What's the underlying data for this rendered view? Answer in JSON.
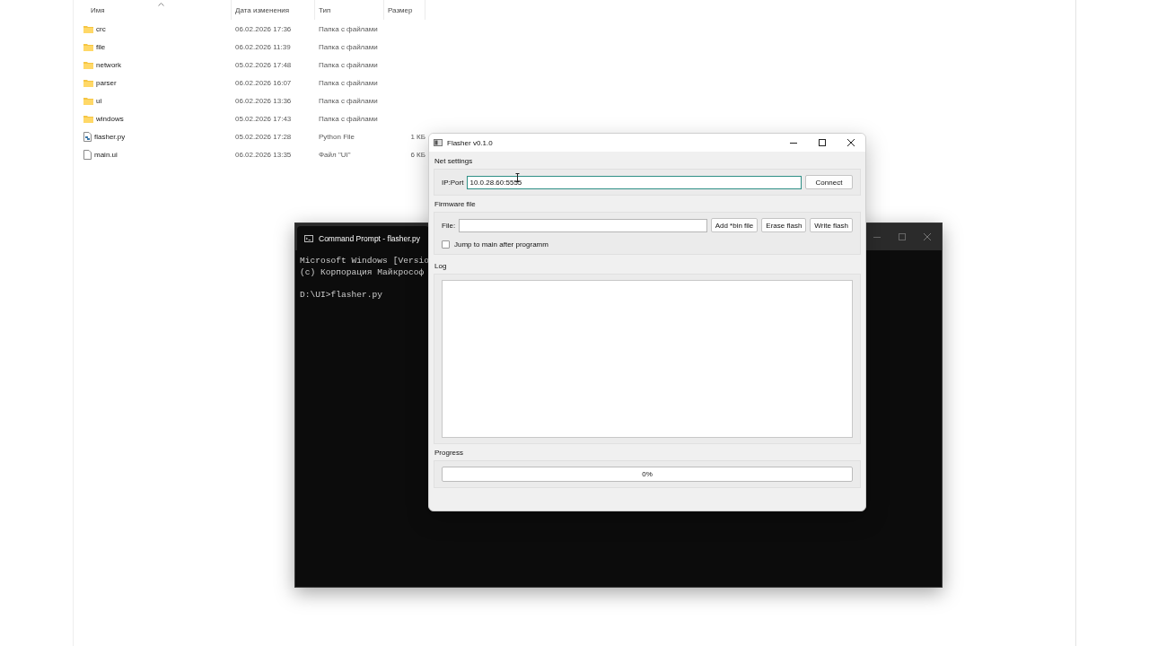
{
  "explorer": {
    "columns": [
      "Имя",
      "Дата изменения",
      "Тип",
      "Размер"
    ],
    "rows": [
      {
        "kind": "folder",
        "name": "crc",
        "date": "06.02.2026 17:36",
        "type": "Папка с файлами"
      },
      {
        "kind": "folder",
        "name": "file",
        "date": "06.02.2026 11:39",
        "type": "Папка с файлами"
      },
      {
        "kind": "folder",
        "name": "network",
        "date": "05.02.2026 17:48",
        "type": "Папка с файлами"
      },
      {
        "kind": "folder",
        "name": "parser",
        "date": "06.02.2026 16:07",
        "type": "Папка с файлами"
      },
      {
        "kind": "folder",
        "name": "ui",
        "date": "06.02.2026 13:36",
        "type": "Папка с файлами"
      },
      {
        "kind": "folder",
        "name": "windows",
        "date": "05.02.2026 17:43",
        "type": "Папка с файлами"
      },
      {
        "kind": "python",
        "name": "flasher.py",
        "date": "05.02.2026 17:28",
        "type": "Python File",
        "size": "1 КБ"
      },
      {
        "kind": "file",
        "name": "main.ui",
        "date": "06.02.2026 13:35",
        "type": "Файл \"UI\"",
        "size": "6 КБ"
      }
    ]
  },
  "console": {
    "title": "Command Prompt - flasher.py",
    "blocks": [
      {
        "lines": [
          "Microsoft Windows [Versio",
          "(c) Корпорация Майкрософ"
        ]
      },
      {
        "lines": [
          "D:\\UI>flasher.py"
        ]
      }
    ]
  },
  "flasher": {
    "title": "Flasher v0.1.0",
    "net_settings": {
      "title": "Net settings",
      "label": "IP:Port",
      "value": "10.0.28.60:5555",
      "focused": true,
      "button": "Connect"
    },
    "firmware": {
      "title": "Firmware file",
      "label": "File:",
      "buttons": [
        "Add *bin file",
        "Erase flash",
        "Write flash"
      ],
      "checkbox": {
        "label": "Jump to main after programm",
        "checked": false
      }
    },
    "log": {
      "title": "Log"
    },
    "progress": {
      "title": "Progress",
      "level": 0,
      "reading": "0%"
    }
  }
}
